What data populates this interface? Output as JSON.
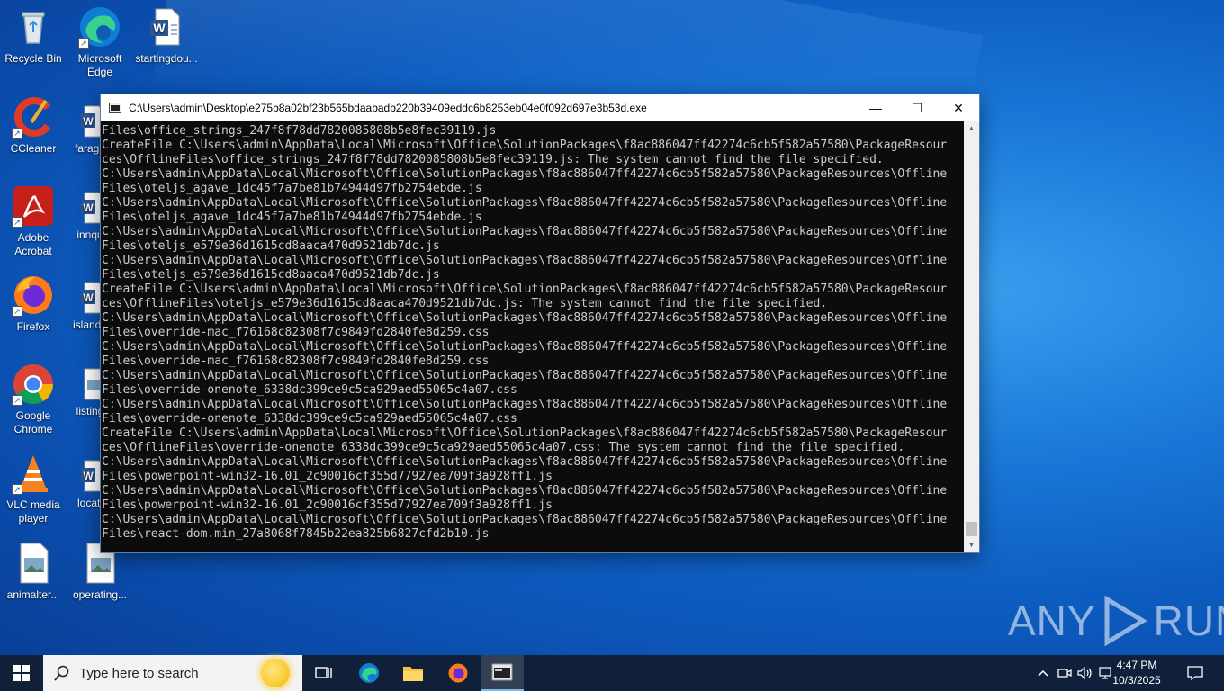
{
  "desktop": {
    "icons": [
      {
        "label": "Recycle Bin"
      },
      {
        "label": "Microsoft Edge"
      },
      {
        "label": "startingdou..."
      },
      {
        "label": "CCleaner"
      },
      {
        "label": "farage"
      },
      {
        "label": "Adobe Acrobat"
      },
      {
        "label": "innqu"
      },
      {
        "label": "Firefox"
      },
      {
        "label": "islandp"
      },
      {
        "label": "Google Chrome"
      },
      {
        "label": "listing"
      },
      {
        "label": "VLC media player"
      },
      {
        "label": "locati"
      },
      {
        "label": "animalter..."
      },
      {
        "label": "operating..."
      }
    ]
  },
  "window": {
    "title": "C:\\Users\\admin\\Desktop\\e275b8a02bf23b565bdaabadb220b39409eddc6b8253eb04e0f092d697e3b53d.exe",
    "minimize_glyph": "—",
    "maximize_glyph": "☐",
    "close_glyph": "✕",
    "console_lines": [
      "Files\\office_strings_247f8f78dd7820085808b5e8fec39119.js",
      "CreateFile C:\\Users\\admin\\AppData\\Local\\Microsoft\\Office\\SolutionPackages\\f8ac886047ff42274c6cb5f582a57580\\PackageResour",
      "ces\\OfflineFiles\\office_strings_247f8f78dd7820085808b5e8fec39119.js: The system cannot find the file specified.",
      "C:\\Users\\admin\\AppData\\Local\\Microsoft\\Office\\SolutionPackages\\f8ac886047ff42274c6cb5f582a57580\\PackageResources\\Offline",
      "Files\\oteljs_agave_1dc45f7a7be81b74944d97fb2754ebde.js",
      "C:\\Users\\admin\\AppData\\Local\\Microsoft\\Office\\SolutionPackages\\f8ac886047ff42274c6cb5f582a57580\\PackageResources\\Offline",
      "Files\\oteljs_agave_1dc45f7a7be81b74944d97fb2754ebde.js",
      "C:\\Users\\admin\\AppData\\Local\\Microsoft\\Office\\SolutionPackages\\f8ac886047ff42274c6cb5f582a57580\\PackageResources\\Offline",
      "Files\\oteljs_e579e36d1615cd8aaca470d9521db7dc.js",
      "C:\\Users\\admin\\AppData\\Local\\Microsoft\\Office\\SolutionPackages\\f8ac886047ff42274c6cb5f582a57580\\PackageResources\\Offline",
      "Files\\oteljs_e579e36d1615cd8aaca470d9521db7dc.js",
      "CreateFile C:\\Users\\admin\\AppData\\Local\\Microsoft\\Office\\SolutionPackages\\f8ac886047ff42274c6cb5f582a57580\\PackageResour",
      "ces\\OfflineFiles\\oteljs_e579e36d1615cd8aaca470d9521db7dc.js: The system cannot find the file specified.",
      "C:\\Users\\admin\\AppData\\Local\\Microsoft\\Office\\SolutionPackages\\f8ac886047ff42274c6cb5f582a57580\\PackageResources\\Offline",
      "Files\\override-mac_f76168c82308f7c9849fd2840fe8d259.css",
      "C:\\Users\\admin\\AppData\\Local\\Microsoft\\Office\\SolutionPackages\\f8ac886047ff42274c6cb5f582a57580\\PackageResources\\Offline",
      "Files\\override-mac_f76168c82308f7c9849fd2840fe8d259.css",
      "C:\\Users\\admin\\AppData\\Local\\Microsoft\\Office\\SolutionPackages\\f8ac886047ff42274c6cb5f582a57580\\PackageResources\\Offline",
      "Files\\override-onenote_6338dc399ce9c5ca929aed55065c4a07.css",
      "C:\\Users\\admin\\AppData\\Local\\Microsoft\\Office\\SolutionPackages\\f8ac886047ff42274c6cb5f582a57580\\PackageResources\\Offline",
      "Files\\override-onenote_6338dc399ce9c5ca929aed55065c4a07.css",
      "CreateFile C:\\Users\\admin\\AppData\\Local\\Microsoft\\Office\\SolutionPackages\\f8ac886047ff42274c6cb5f582a57580\\PackageResour",
      "ces\\OfflineFiles\\override-onenote_6338dc399ce9c5ca929aed55065c4a07.css: The system cannot find the file specified.",
      "C:\\Users\\admin\\AppData\\Local\\Microsoft\\Office\\SolutionPackages\\f8ac886047ff42274c6cb5f582a57580\\PackageResources\\Offline",
      "Files\\powerpoint-win32-16.01_2c90016cf355d77927ea709f3a928ff1.js",
      "C:\\Users\\admin\\AppData\\Local\\Microsoft\\Office\\SolutionPackages\\f8ac886047ff42274c6cb5f582a57580\\PackageResources\\Offline",
      "Files\\powerpoint-win32-16.01_2c90016cf355d77927ea709f3a928ff1.js",
      "C:\\Users\\admin\\AppData\\Local\\Microsoft\\Office\\SolutionPackages\\f8ac886047ff42274c6cb5f582a57580\\PackageResources\\Offline",
      "Files\\react-dom.min_27a8068f7845b22ea825b6827cfd2b10.js"
    ]
  },
  "watermark": {
    "left": "ANY",
    "right": "RUN"
  },
  "taskbar": {
    "search_placeholder": "Type here to search",
    "clock_time": "4:47 PM",
    "clock_date": "10/3/2025"
  },
  "colors": {
    "console_bg": "#0c0c0c",
    "console_text": "#cccccc",
    "taskbar": "#121c30",
    "accent": "#0a63c9"
  }
}
